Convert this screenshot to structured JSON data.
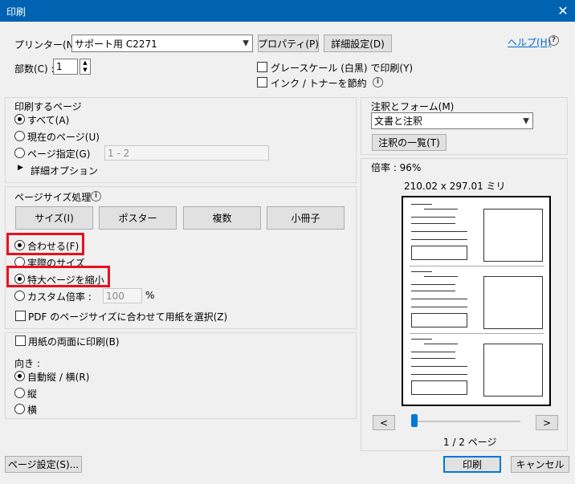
{
  "window": {
    "title": "印刷",
    "close_glyph": "✕"
  },
  "printer": {
    "label": "プリンター(N) :",
    "selected": "サポート用 C2271",
    "properties_btn": "プロパティ(P)",
    "advanced_btn": "詳細設定(D)",
    "help_link": "ヘルプ(H)"
  },
  "copies": {
    "label": "部数(C) :",
    "value": "1"
  },
  "options": {
    "grayscale": "グレースケール (白黒) で印刷(Y)",
    "save_ink": "インク / トナーを節約"
  },
  "pages_to_print": {
    "title": "印刷するページ",
    "all": "すべて(A)",
    "current": "現在のページ(U)",
    "range": "ページ指定(G)",
    "range_value": "1 - 2",
    "more": "詳細オプション"
  },
  "page_sizing": {
    "title": "ページサイズ処理",
    "tabs": [
      "サイズ(I)",
      "ポスター",
      "複数",
      "小冊子"
    ],
    "fit": "合わせる(F)",
    "actual": "実際のサイズ",
    "shrink": "特大ページを縮小",
    "custom": "カスタム倍率 :",
    "custom_value": "100",
    "percent": "%",
    "pdf_paper": "PDF のページサイズに合わせて用紙を選択(Z)"
  },
  "duplex": {
    "label": "用紙の両面に印刷(B)"
  },
  "orientation": {
    "title": "向き :",
    "auto": "自動縦 / 横(R)",
    "portrait": "縦",
    "landscape": "横"
  },
  "comments": {
    "title": "注釈とフォーム(M)",
    "selected": "文書と注釈",
    "summary_btn": "注釈の一覧(T)"
  },
  "preview": {
    "scale": "倍率 : 96%",
    "dims": "210.02 x 297.01 ミリ",
    "prev": "<",
    "next": ">",
    "page_info": "1 / 2 ページ",
    "page_fraction": 0
  },
  "footer": {
    "page_setup": "ページ設定(S)...",
    "print": "印刷",
    "cancel": "キャンセル"
  },
  "colors": {
    "accent": "#0078d7",
    "titlebar": "#0063b1",
    "highlight": "#e8101e"
  }
}
